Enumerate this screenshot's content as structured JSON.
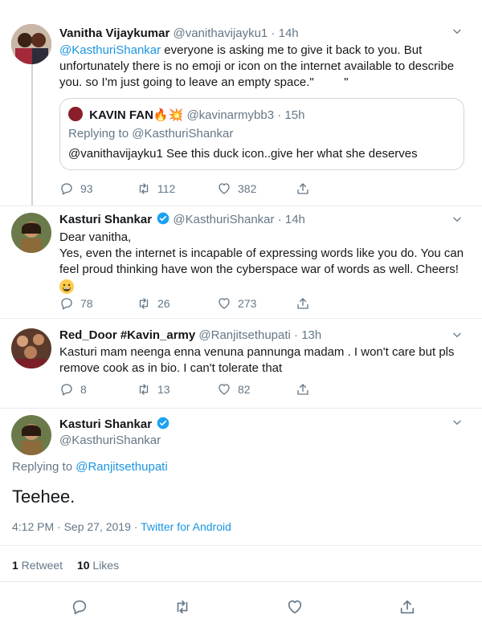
{
  "tweet1": {
    "name": "Vanitha Vijaykumar",
    "handle": "@vanithavijayku1",
    "time": "14h",
    "mention": "@KasthuriShankar",
    "line1": " everyone is asking me to give it back to you. But",
    "line2": "unfortunately there is no emoji or icon on the internet available to describe",
    "line3": "you. so I'm just going to leave an empty space.\"         \"",
    "quote": {
      "name": "KAVIN FAN",
      "emoji": "🔥💥",
      "handle": "@kavinarmybb3",
      "time": "15h",
      "replying_prefix": "Replying to ",
      "replying_to": "@KasthuriShankar",
      "text": "@vanithavijayku1 See this duck icon..give her what she deserves"
    },
    "replies": "93",
    "retweets": "112",
    "likes": "382"
  },
  "tweet2": {
    "name": "Kasturi Shankar",
    "handle": "@KasthuriShankar",
    "time": "14h",
    "line1": "Dear vanitha,",
    "line2": "Yes, even the internet is incapable of expressing words like you do.  You can",
    "line3": "feel proud thinking have won the cyberspace war of words as well. Cheers!",
    "replies": "78",
    "retweets": "26",
    "likes": "273"
  },
  "tweet3": {
    "name": "Red_Door #Kavin_army",
    "handle": "@Ranjitsethupati",
    "time": "13h",
    "line1": "Kasturi mam neenga enna venuna pannunga madam . I won't care but pls",
    "line2": "remove cook as in bio. I can't tolerate that",
    "replies": "8",
    "retweets": "13",
    "likes": "82"
  },
  "main": {
    "name": "Kasturi Shankar",
    "handle": "@KasthuriShankar",
    "replying_prefix": "Replying to ",
    "replying_to": "@Ranjitsethupati",
    "text": "Teehee.",
    "timestamp": "4:12 PM · Sep 27, 2019 · ",
    "source": "Twitter for Android",
    "retweet_count": "1",
    "retweet_label": " Retweet",
    "like_count": "10",
    "like_label": " Likes"
  },
  "colors": {
    "link": "#1b95e0",
    "muted": "#657786",
    "border": "#e6ecf0"
  }
}
